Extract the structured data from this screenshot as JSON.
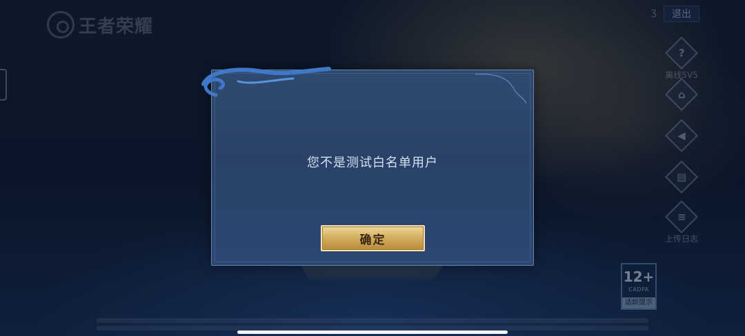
{
  "app": {
    "logo_text": "王者荣耀"
  },
  "topbar": {
    "exit_label": "退出",
    "lang_symbol": "ʒ"
  },
  "side_menu": [
    {
      "icon": "question-icon",
      "glyph": "?",
      "label": "离线5V5"
    },
    {
      "icon": "gamepad-icon",
      "glyph": "⌂",
      "label": ""
    },
    {
      "icon": "speaker-icon",
      "glyph": "◀",
      "label": ""
    },
    {
      "icon": "device-icon",
      "glyph": "▤",
      "label": ""
    },
    {
      "icon": "clipboard-icon",
      "glyph": "≡",
      "label": "上传日志"
    }
  ],
  "age_badge": {
    "rating": "12+",
    "org": "CADPA",
    "note": "适龄提示"
  },
  "dialog": {
    "message": "您不是测试白名单用户",
    "confirm_label": "确定"
  },
  "colors": {
    "dialog_bg": "#2c4670",
    "button_gold": "#d4b063",
    "text_light": "#d4e1f2"
  }
}
